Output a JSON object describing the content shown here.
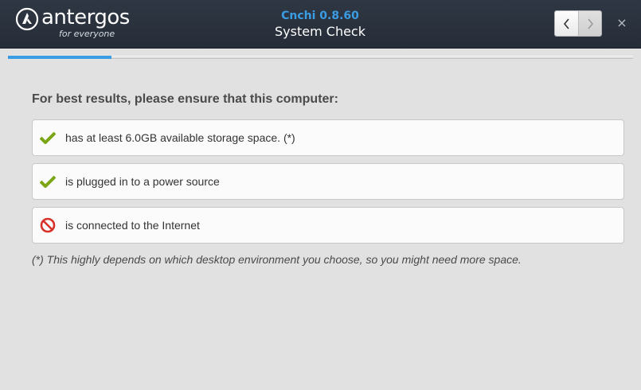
{
  "brand": {
    "name": "antergos",
    "tagline": "for everyone"
  },
  "header": {
    "app_version": "Cnchi 0.8.60",
    "page_title": "System Check"
  },
  "nav": {
    "back_icon": "chevron-left-icon",
    "forward_icon": "chevron-right-icon",
    "close_icon": "close-icon",
    "close_glyph": "×"
  },
  "progress": {
    "fraction": 0.165,
    "color": "#3a9de4"
  },
  "main": {
    "heading": "For best results, please ensure that this computer:",
    "checks": [
      {
        "label": "has at least 6.0GB available storage space. (*)",
        "status": "ok",
        "icon": "checkmark-icon"
      },
      {
        "label": "is plugged in to a power source",
        "status": "ok",
        "icon": "checkmark-icon"
      },
      {
        "label": "is connected to the Internet",
        "status": "fail",
        "icon": "prohibited-icon"
      }
    ],
    "footnote": "(*) This highly depends on which desktop environment you choose, so you might need more space."
  },
  "colors": {
    "ok": "#7ba617",
    "fail": "#d8312a",
    "accent": "#3a9de4"
  }
}
